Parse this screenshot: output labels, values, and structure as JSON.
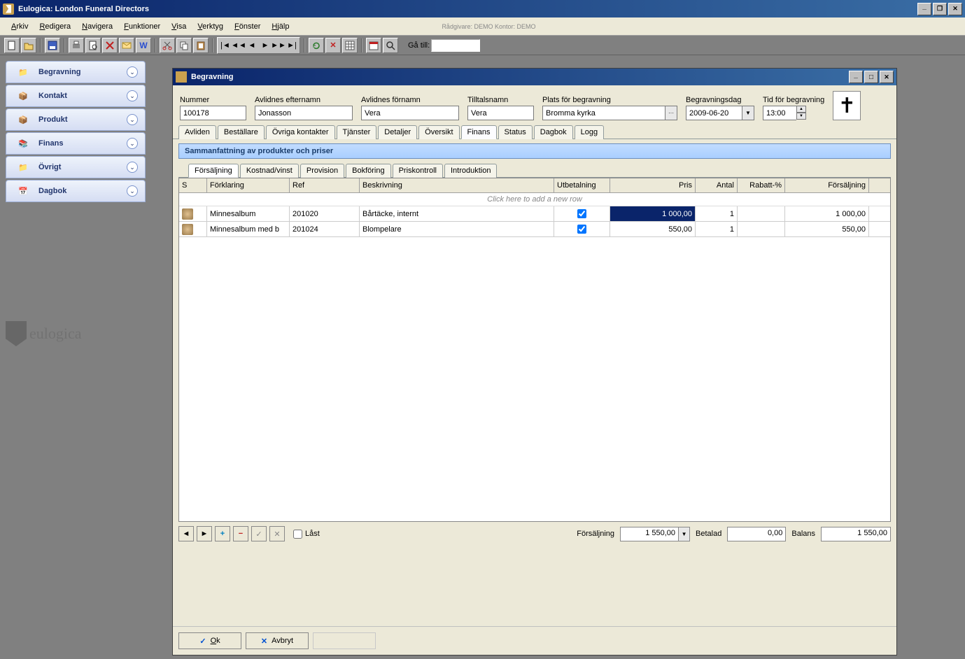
{
  "app": {
    "title": "Eulogica: London Funeral Directors",
    "brand": "eulogica"
  },
  "menubar": [
    "Arkiv",
    "Redigera",
    "Navigera",
    "Funktioner",
    "Visa",
    "Verktyg",
    "Fönster",
    "Hjälp"
  ],
  "advisor_text": "Rådgivare: DEMO   Kontor: DEMO",
  "goto_label": "Gå till:",
  "sidebar": {
    "items": [
      {
        "label": "Begravning"
      },
      {
        "label": "Kontakt"
      },
      {
        "label": "Produkt"
      },
      {
        "label": "Finans"
      },
      {
        "label": "Övrigt"
      },
      {
        "label": "Dagbok"
      }
    ]
  },
  "window": {
    "title": "Begravning",
    "fields": {
      "nummer_label": "Nummer",
      "nummer": "100178",
      "efternamn_label": "Avlidnes efternamn",
      "efternamn": "Jonasson",
      "fornamn_label": "Avlidnes förnamn",
      "fornamn": "Vera",
      "tilltal_label": "Tilltalsnamn",
      "tilltal": "Vera",
      "plats_label": "Plats för begravning",
      "plats": "Bromma kyrka",
      "dag_label": "Begravningsdag",
      "dag": "2009-06-20",
      "tid_label": "Tid för begravning",
      "tid": "13:00"
    },
    "tabs": [
      "Avliden",
      "Beställare",
      "Övriga kontakter",
      "Tjänster",
      "Detaljer",
      "Översikt",
      "Finans",
      "Status",
      "Dagbok",
      "Logg"
    ],
    "active_tab": "Finans",
    "section_title": "Sammanfattning av produkter och priser",
    "subtabs": [
      "Försäljning",
      "Kostnad/vinst",
      "Provision",
      "Bokföring",
      "Priskontroll",
      "Introduktion"
    ],
    "active_subtab": "Försäljning",
    "columns": [
      "S",
      "Förklaring",
      "Ref",
      "Beskrivning",
      "Utbetalning",
      "Pris",
      "Antal",
      "Rabatt-%",
      "Försäljning"
    ],
    "add_row_hint": "Click here to add a new row",
    "rows": [
      {
        "forklaring": "Minnesalbum",
        "ref": "201020",
        "besk": "Bårtäcke, internt",
        "utb": true,
        "pris": "1 000,00",
        "antal": "1",
        "rabatt": "",
        "forsaljning": "1 000,00",
        "selected_price": true
      },
      {
        "forklaring": "Minnesalbum med b",
        "ref": "201024",
        "besk": "Blompelare",
        "utb": true,
        "pris": "550,00",
        "antal": "1",
        "rabatt": "",
        "forsaljning": "550,00",
        "selected_price": false
      }
    ],
    "footer": {
      "last_label": "Låst",
      "sum_label": "Försäljning",
      "sum": "1 550,00",
      "betalad_label": "Betalad",
      "betalad": "0,00",
      "balans_label": "Balans",
      "balans": "1 550,00"
    },
    "buttons": {
      "ok": "Ok",
      "cancel": "Avbryt"
    }
  }
}
